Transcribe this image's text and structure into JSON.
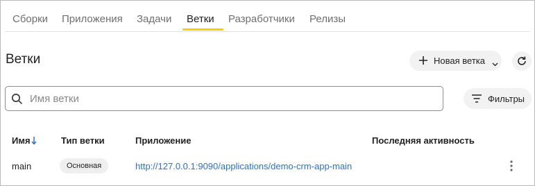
{
  "tabs": [
    {
      "label": "Сборки",
      "active": false
    },
    {
      "label": "Приложения",
      "active": false
    },
    {
      "label": "Задачи",
      "active": false
    },
    {
      "label": "Ветки",
      "active": true
    },
    {
      "label": "Разработчики",
      "active": false
    },
    {
      "label": "Релизы",
      "active": false
    }
  ],
  "colors": {
    "accent": "#ffcc00",
    "link": "#2f6fd0"
  },
  "header": {
    "title": "Ветки",
    "new_branch_label": "Новая ветка",
    "refresh_icon": "refresh-icon"
  },
  "search": {
    "placeholder": "Имя ветки",
    "value": ""
  },
  "filters_label": "Фильтры",
  "table": {
    "columns": [
      "Имя",
      "Тип ветки",
      "Приложение",
      "Последняя активность"
    ],
    "sort": {
      "column": "Имя",
      "direction": "desc",
      "icon": "arrow-down-icon"
    },
    "rows": [
      {
        "name": "main",
        "type": "Основная",
        "application": "http://127.0.0.1:9090/applications/demo-crm-app-main",
        "last_activity": ""
      }
    ]
  }
}
